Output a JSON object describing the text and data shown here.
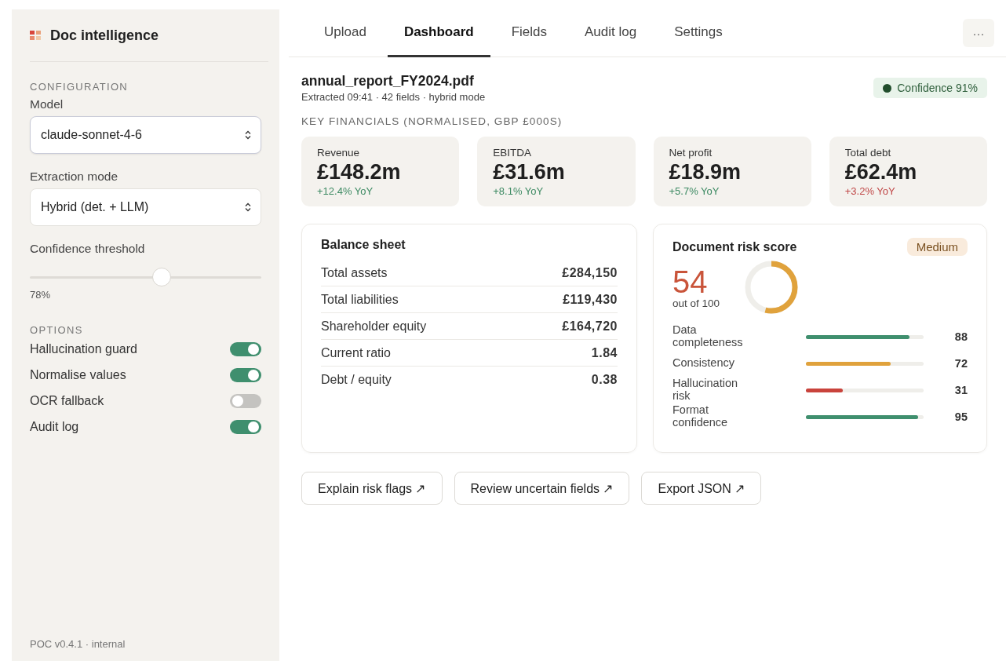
{
  "sidebar": {
    "app_title": "Doc intelligence",
    "configuration": {
      "heading": "CONFIGURATION",
      "model": {
        "label": "Model",
        "value": "claude-sonnet-4-6"
      },
      "extraction_mode": {
        "label": "Extraction mode",
        "value": "Hybrid (det. + LLM)"
      },
      "threshold": {
        "label": "Confidence threshold",
        "level": 0.57,
        "reading": "78%"
      }
    },
    "options": {
      "heading": "OPTIONS",
      "items": [
        {
          "label": "Hallucination guard",
          "on": true
        },
        {
          "label": "Normalise values",
          "on": true
        },
        {
          "label": "OCR fallback",
          "on": false
        },
        {
          "label": "Audit log",
          "on": true
        }
      ]
    },
    "footer": "POC v0.4.1 · internal"
  },
  "tabs": [
    {
      "label": "Upload",
      "selected": false
    },
    {
      "label": "Dashboard",
      "selected": true
    },
    {
      "label": "Fields",
      "selected": false
    },
    {
      "label": "Audit log",
      "selected": false
    },
    {
      "label": "Settings",
      "selected": false
    }
  ],
  "more_button": "···",
  "document": {
    "filename": "annual_report_FY2024.pdf",
    "meta": "Extracted 09:41 · 42 fields · hybrid mode",
    "confidence": "Confidence 91%"
  },
  "key_financials": {
    "heading": "KEY FINANCIALS (NORMALISED, GBP £000S)",
    "cards": [
      {
        "label": "Revenue",
        "value": "£148.2m",
        "change": "+12.4% YoY",
        "color": "#3d8a63"
      },
      {
        "label": "EBITDA",
        "value": "£31.6m",
        "change": "+8.1% YoY",
        "color": "#3d8a63"
      },
      {
        "label": "Net profit",
        "value": "£18.9m",
        "change": "+5.7% YoY",
        "color": "#3d8a63"
      },
      {
        "label": "Total debt",
        "value": "£62.4m",
        "change": "+3.2% YoY",
        "color": "#c04848"
      }
    ]
  },
  "balance_sheet": {
    "title": "Balance sheet",
    "rows": [
      {
        "label": "Total assets",
        "value": "£284,150"
      },
      {
        "label": "Total liabilities",
        "value": "£119,430"
      },
      {
        "label": "Shareholder equity",
        "value": "£164,720"
      },
      {
        "label": "Current ratio",
        "value": "1.84"
      },
      {
        "label": "Debt / equity",
        "value": "0.38"
      }
    ]
  },
  "risk": {
    "title": "Document risk score",
    "badge": "Medium",
    "score": "54",
    "out_of": "out of 100",
    "level": 0.54,
    "factors": [
      {
        "label": "Data completeness",
        "level": 0.88,
        "value": "88",
        "color": "#3f8f6e"
      },
      {
        "label": "Consistency",
        "level": 0.72,
        "value": "72",
        "color": "#e0a23c"
      },
      {
        "label": "Hallucination risk",
        "level": 0.31,
        "value": "31",
        "color": "#c9433c"
      },
      {
        "label": "Format confidence",
        "level": 0.95,
        "value": "95",
        "color": "#3f8f6e"
      }
    ]
  },
  "actions": [
    "Explain risk flags ↗",
    "Review uncertain fields ↗",
    "Export JSON ↗"
  ]
}
